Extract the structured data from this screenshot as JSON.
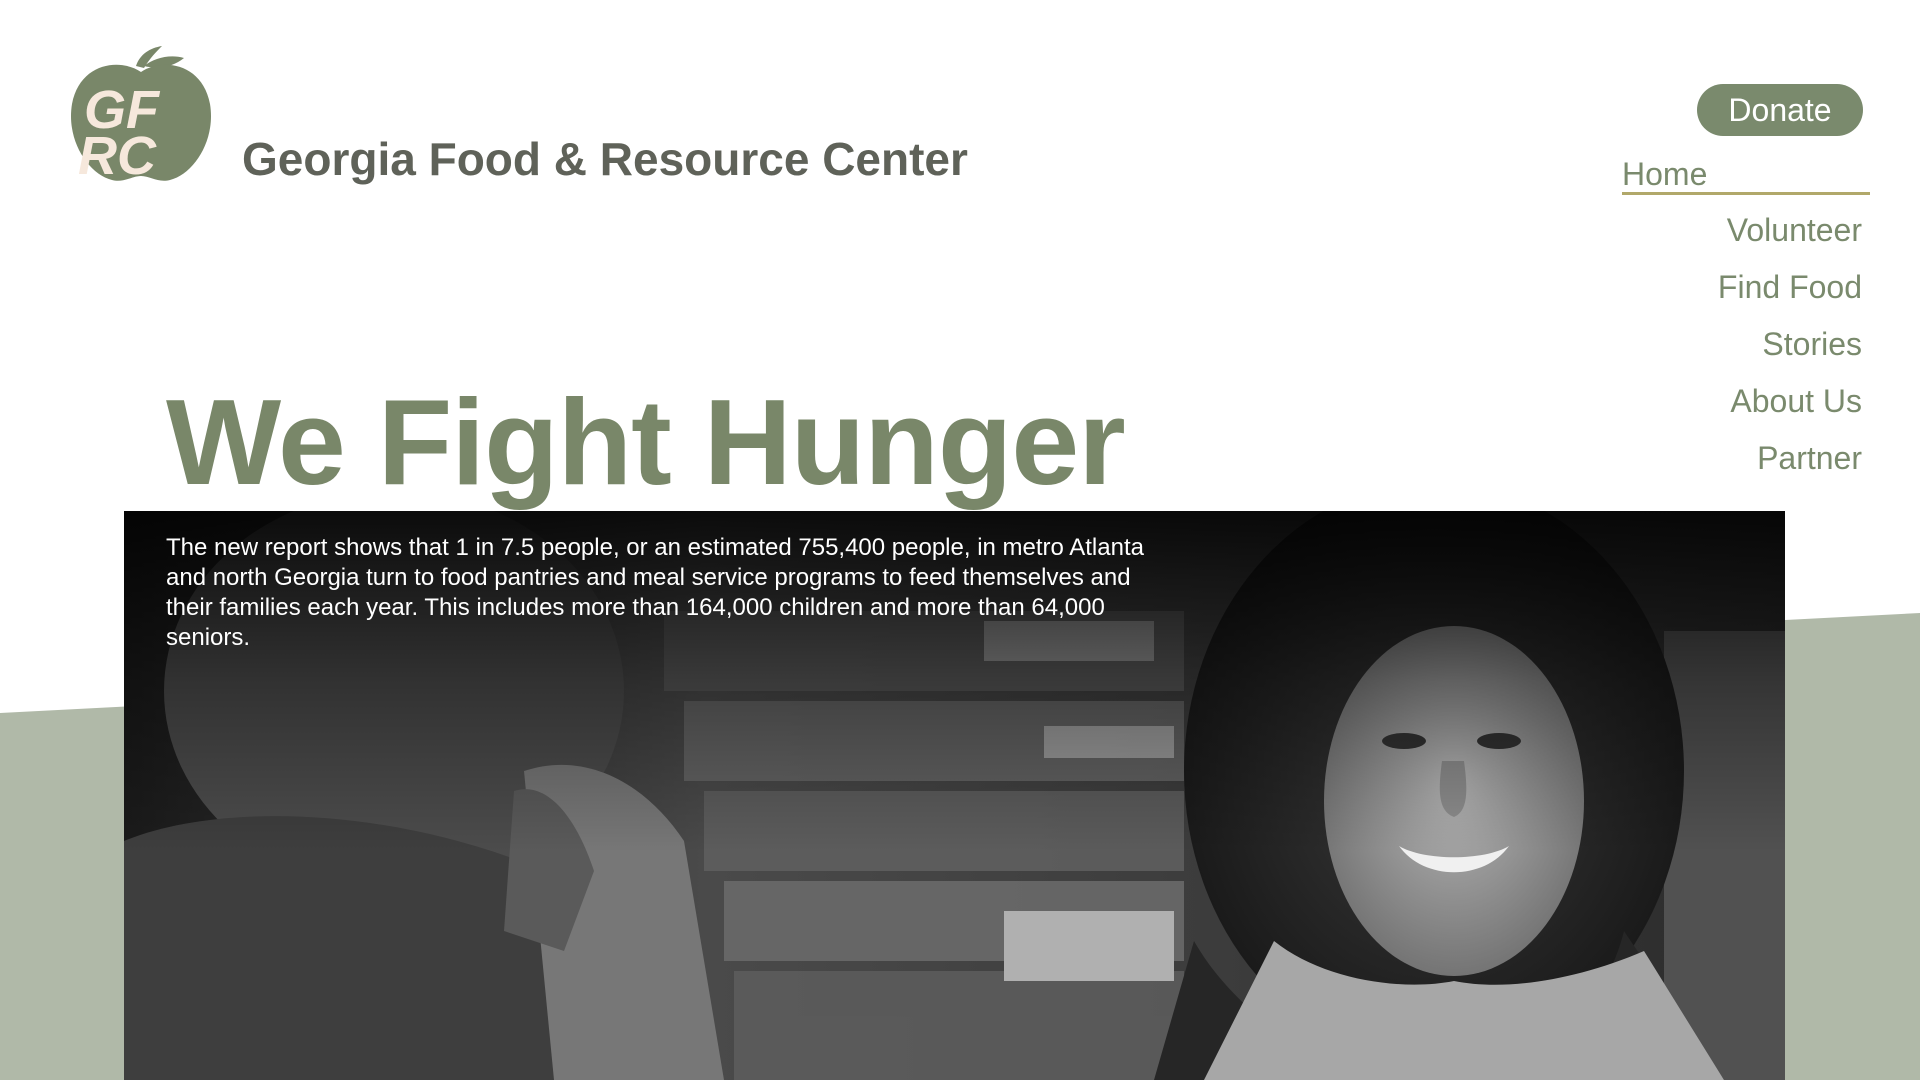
{
  "header": {
    "logo_letters": "GFRC",
    "site_title": "Georgia Food & Resource Center"
  },
  "nav": {
    "donate_label": "Donate",
    "items": [
      {
        "label": "Home",
        "active": true
      },
      {
        "label": "Volunteer"
      },
      {
        "label": "Find Food"
      },
      {
        "label": "Stories"
      },
      {
        "label": "About Us"
      },
      {
        "label": "Partner"
      }
    ]
  },
  "hero": {
    "title": "We Fight Hunger",
    "body": "The new report shows that 1 in 7.5 people, or an estimated 755,400 people, in metro Atlanta and north Georgia turn to food pantries and meal service programs to feed themselves and their families each year. This includes more than 164,000 children and more than 64,000 seniors.",
    "image": "black-and-white-photo-smiling-girl-food-pantry"
  },
  "colors": {
    "brand_green": "#798769",
    "title_gray": "#5f6259",
    "band_green": "#b0b9a8",
    "underline_gold": "#b1a86a",
    "logo_letters": "#f6e8dc"
  }
}
